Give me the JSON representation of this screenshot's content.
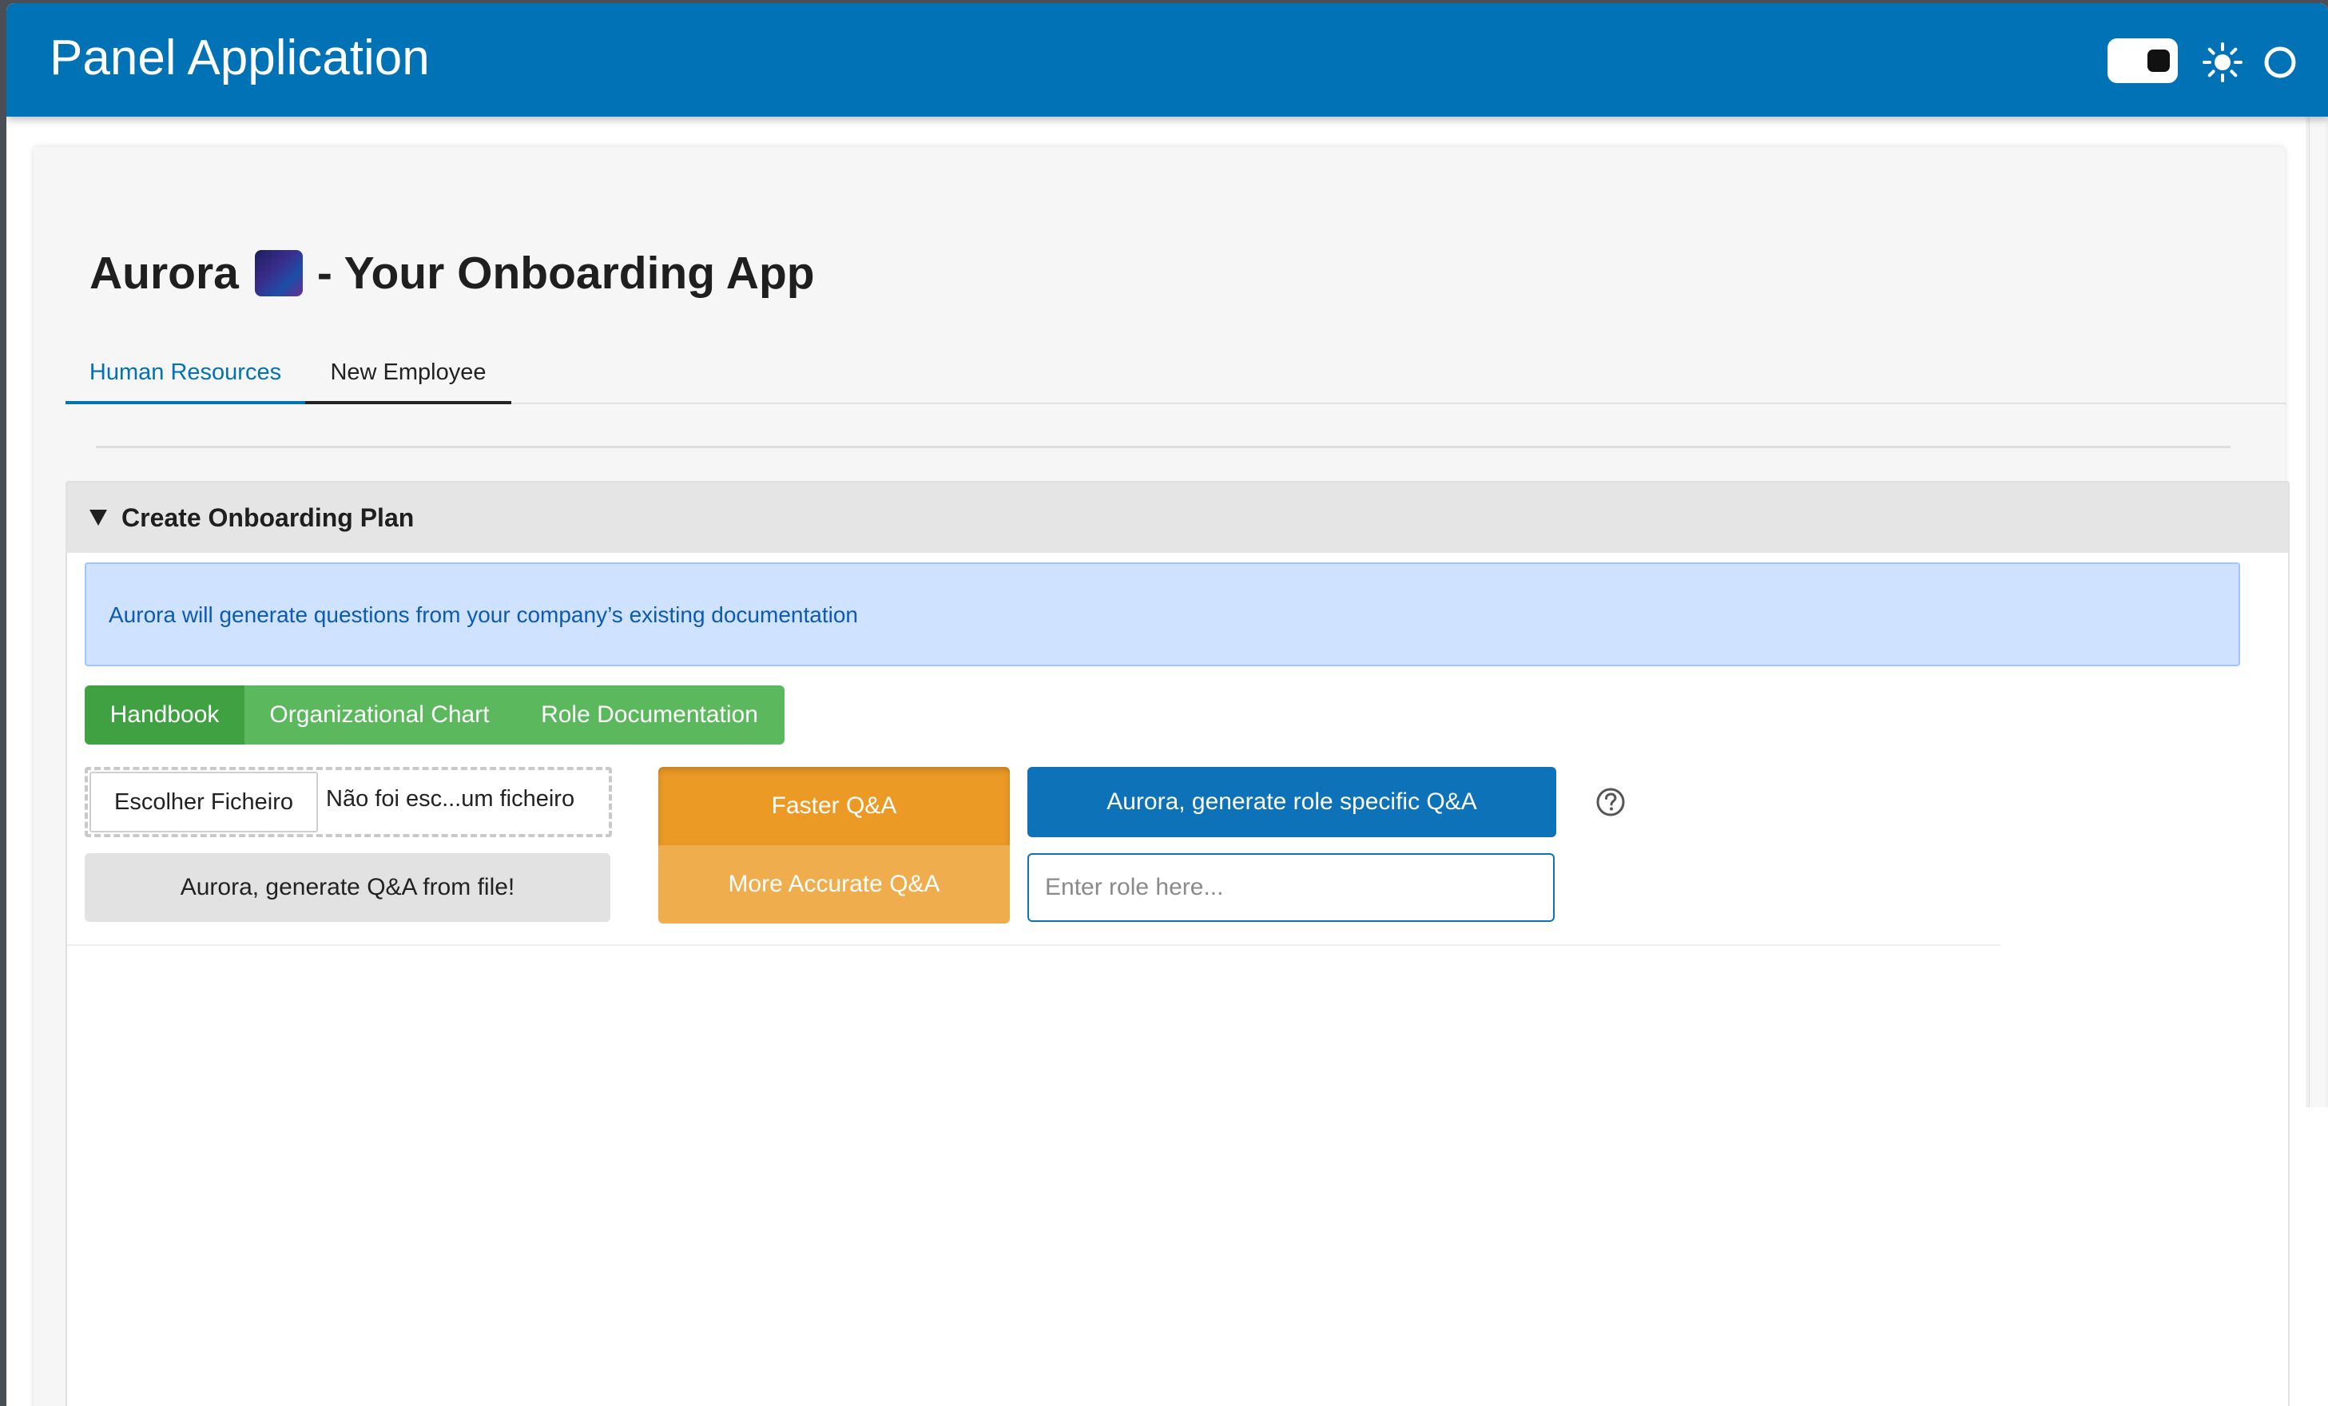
{
  "header": {
    "title": "Panel Application",
    "color": "#0072b5",
    "icons": [
      "theme-toggle",
      "sun-icon",
      "circle-icon"
    ]
  },
  "page": {
    "title_prefix": "Aurora",
    "title_suffix": "- Your Onboarding App",
    "title_image": "aurora-image"
  },
  "tabs": [
    {
      "label": "Human Resources",
      "active": true
    },
    {
      "label": "New Employee",
      "active": false
    }
  ],
  "panel": {
    "title": "Create Onboarding Plan",
    "expanded": true,
    "alert": "Aurora will generate questions from your company’s existing documentation",
    "doc_types": [
      {
        "label": "Handbook",
        "selected": true
      },
      {
        "label": "Organizational Chart",
        "selected": false
      },
      {
        "label": "Role Documentation",
        "selected": false
      }
    ],
    "file_input": {
      "button_label": "Escolher Ficheiro",
      "status": "Não foi esc...um ficheiro"
    },
    "generate_file_button": "Aurora, generate Q&A from file!",
    "modes": [
      {
        "label": "Faster Q&A",
        "selected": true
      },
      {
        "label": "More Accurate Q&A",
        "selected": false
      }
    ],
    "role_button": "Aurora, generate role specific Q&A",
    "role_input": {
      "placeholder": "Enter role here...",
      "value": ""
    },
    "help_icon": "question-circle-icon"
  },
  "colors": {
    "primary": "#0072b5",
    "success": "#5cb85c",
    "success_active": "#3fa142",
    "warning": "#f0ad4e",
    "warning_active": "#ec9a26",
    "info_bg": "#cfe2ff",
    "info_text": "#0b5ab5"
  }
}
